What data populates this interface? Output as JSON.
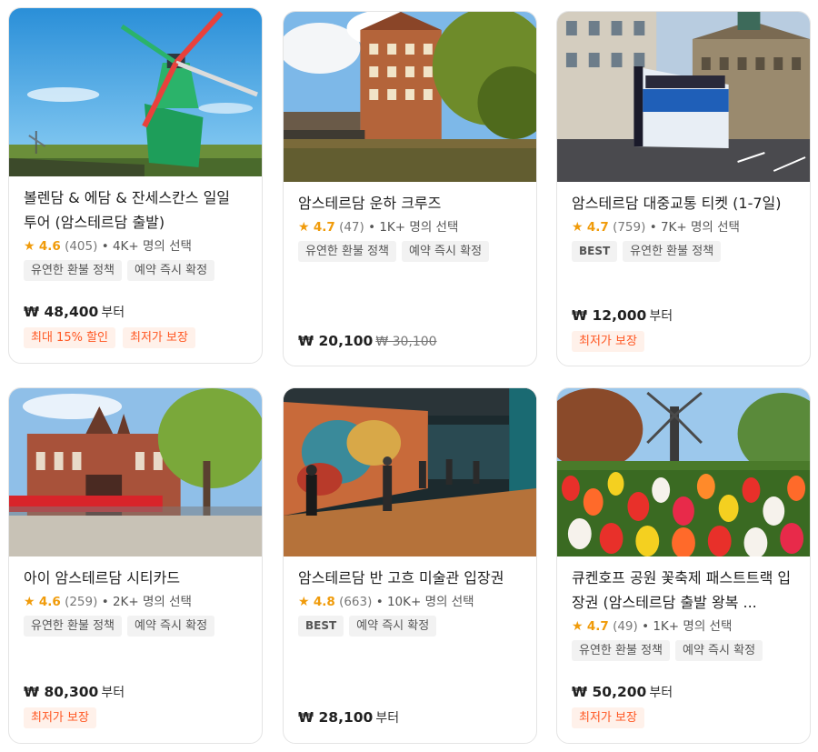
{
  "cards": [
    {
      "title": "볼렌담 & 에담 & 잔세스칸스 일일 투어 (암스테르담 출발)",
      "score": "4.6",
      "reviews": "(405)",
      "booked": "• 4K+ 명의 선택",
      "tags": [
        "유연한 환불 정책",
        "예약 즉시 확정"
      ],
      "price": "₩ 48,400",
      "price_suffix": "부터",
      "promos": [
        "최대 15% 할인",
        "최저가 보장"
      ]
    },
    {
      "title": "암스테르담 운하 크루즈",
      "score": "4.7",
      "reviews": "(47)",
      "booked": "• 1K+ 명의 선택",
      "tags": [
        "유연한 환불 정책",
        "예약 즉시 확정"
      ],
      "price": "₩ 20,100",
      "original_price": "₩ 30,100",
      "promos": []
    },
    {
      "title": "암스테르담 대중교통 티켓 (1-7일)",
      "score": "4.7",
      "reviews": "(759)",
      "booked": "• 7K+ 명의 선택",
      "tags": [
        "BEST",
        "유연한 환불 정책"
      ],
      "price": "₩ 12,000",
      "price_suffix": "부터",
      "promos": [
        "최저가 보장"
      ]
    },
    {
      "title": "아이 암스테르담 시티카드",
      "score": "4.6",
      "reviews": "(259)",
      "booked": "• 2K+ 명의 선택",
      "tags": [
        "유연한 환불 정책",
        "예약 즉시 확정"
      ],
      "price": "₩ 80,300",
      "price_suffix": "부터",
      "promos": [
        "최저가 보장"
      ]
    },
    {
      "title": "암스테르담 반 고흐 미술관 입장권",
      "score": "4.8",
      "reviews": "(663)",
      "booked": "• 10K+ 명의 선택",
      "tags": [
        "BEST",
        "예약 즉시 확정"
      ],
      "price": "₩ 28,100",
      "price_suffix": "부터",
      "promos": []
    },
    {
      "title": "큐켄호프 공원 꽃축제 패스트트랙 입장권 (암스테르담 출발 왕복 ...",
      "score": "4.7",
      "reviews": "(49)",
      "booked": "• 1K+ 명의 선택",
      "tags": [
        "유연한 환불 정책",
        "예약 즉시 확정"
      ],
      "price": "₩ 50,200",
      "price_suffix": "부터",
      "promos": [
        "최저가 보장"
      ]
    }
  ],
  "colors": {
    "star": "#f09b0a",
    "promo_text": "#ff5722",
    "promo_bg": "#fff1ea",
    "tag_bg": "#f2f2f2"
  },
  "icons": {
    "rating": "star-icon"
  }
}
